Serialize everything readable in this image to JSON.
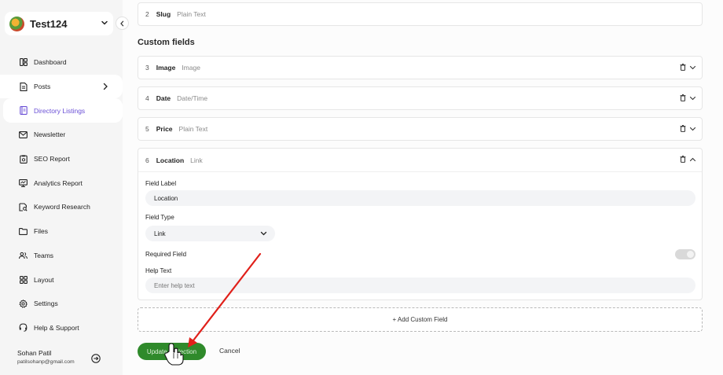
{
  "workspace": {
    "name": "Test124"
  },
  "sidebar": {
    "items": [
      {
        "label": "Dashboard",
        "icon": "dashboard-icon"
      },
      {
        "label": "Posts",
        "icon": "posts-icon"
      },
      {
        "label": "Directory Listings",
        "icon": "directory-icon"
      },
      {
        "label": "Newsletter",
        "icon": "mail-icon"
      },
      {
        "label": "SEO Report",
        "icon": "report-icon"
      },
      {
        "label": "Analytics Report",
        "icon": "monitor-icon"
      },
      {
        "label": "Keyword Research",
        "icon": "keyword-search-icon"
      },
      {
        "label": "Files",
        "icon": "folder-icon"
      },
      {
        "label": "Teams",
        "icon": "users-icon"
      },
      {
        "label": "Layout",
        "icon": "layout-icon"
      },
      {
        "label": "Settings",
        "icon": "gear-icon"
      },
      {
        "label": "Help & Support",
        "icon": "help-icon"
      }
    ],
    "active": "Directory Listings"
  },
  "user": {
    "name": "Sohan Patil",
    "email": "patilsohanp@gmail.com"
  },
  "fields": {
    "slug": {
      "num": "2",
      "name": "Slug",
      "type": "Plain Text"
    },
    "section_title": "Custom fields",
    "custom": [
      {
        "num": "3",
        "name": "Image",
        "type": "Image"
      },
      {
        "num": "4",
        "name": "Date",
        "type": "Date/Time"
      },
      {
        "num": "5",
        "name": "Price",
        "type": "Plain Text"
      }
    ],
    "expanded": {
      "num": "6",
      "name": "Location",
      "type": "Link",
      "field_label_title": "Field Label",
      "field_label_value": "Location",
      "field_type_title": "Field Type",
      "field_type_value": "Link",
      "required_title": "Required Field",
      "required_on": false,
      "help_title": "Help Text",
      "help_placeholder": "Enter help text"
    }
  },
  "actions": {
    "add_field": "+ Add Custom Field",
    "update": "Update Collection",
    "cancel": "Cancel"
  },
  "colors": {
    "accent": "#6a4fd6",
    "primary_button": "#2f8a2b",
    "annotation_arrow": "#e0201a"
  }
}
